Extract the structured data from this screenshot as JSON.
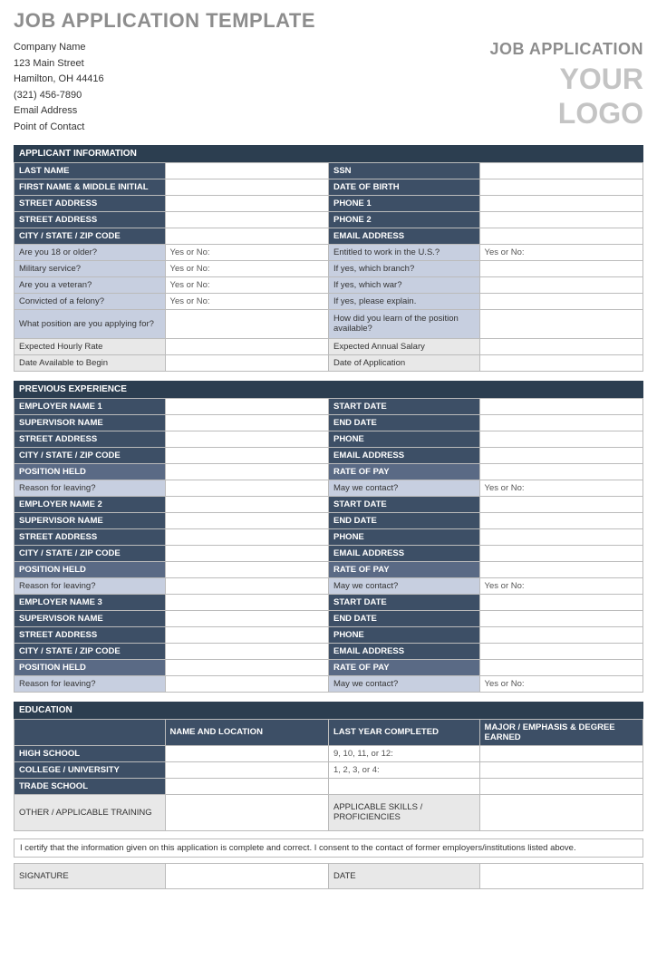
{
  "title": "JOB APPLICATION TEMPLATE",
  "header": {
    "company": "Company Name",
    "address1": "123 Main Street",
    "address2": "Hamilton, OH 44416",
    "phone": "(321) 456-7890",
    "email": "Email Address",
    "contact": "Point of Contact",
    "app_label": "JOB APPLICATION",
    "logo1": "YOUR",
    "logo2": "LOGO"
  },
  "sec_applicant": "APPLICANT INFORMATION",
  "ai": {
    "last_name": "LAST NAME",
    "ssn": "SSN",
    "first_mi": "FIRST NAME & MIDDLE INITIAL",
    "dob": "DATE OF BIRTH",
    "street1": "STREET ADDRESS",
    "phone1": "PHONE 1",
    "street2": "STREET ADDRESS",
    "phone2": "PHONE 2",
    "csz": "CITY / STATE / ZIP CODE",
    "email": "EMAIL ADDRESS",
    "q18": "Are you 18 or older?",
    "yn": "Yes or No:",
    "entitled": "Entitled to work in the U.S.?",
    "military": "Military service?",
    "branch": "If yes, which branch?",
    "veteran": "Are you a veteran?",
    "war": "If yes, which war?",
    "felony": "Convicted of a felony?",
    "explain": "If yes, please explain.",
    "position": "What position are you applying for?",
    "learn": "How did you learn of the position available?",
    "hourly": "Expected Hourly Rate",
    "salary": "Expected Annual Salary",
    "avail": "Date Available to Begin",
    "appdate": "Date of Application"
  },
  "sec_prev": "PREVIOUS EXPERIENCE",
  "pe": {
    "emp1": "EMPLOYER NAME 1",
    "emp2": "EMPLOYER NAME 2",
    "emp3": "EMPLOYER NAME 3",
    "sup": "SUPERVISOR NAME",
    "street": "STREET ADDRESS",
    "csz": "CITY / STATE / ZIP CODE",
    "pos": "POSITION HELD",
    "reason": "Reason for leaving?",
    "start": "START DATE",
    "end": "END DATE",
    "phone": "PHONE",
    "email": "EMAIL ADDRESS",
    "rate": "RATE OF PAY",
    "contact": "May we contact?",
    "yn": "Yes or No:"
  },
  "sec_edu": "EDUCATION",
  "edu": {
    "col_name": "NAME AND LOCATION",
    "col_year": "LAST YEAR COMPLETED",
    "col_major": "MAJOR / EMPHASIS & DEGREE EARNED",
    "hs": "HIGH SCHOOL",
    "hs_years": "9, 10, 11, or 12:",
    "college": "COLLEGE / UNIVERSITY",
    "col_years": "1, 2, 3, or 4:",
    "trade": "TRADE SCHOOL",
    "other": "OTHER / APPLICABLE TRAINING",
    "skills": "APPLICABLE SKILLS / PROFICIENCIES"
  },
  "cert": "I certify that the information given on this application is complete and correct. I consent to the contact of former employers/institutions listed above.",
  "sig": {
    "signature": "SIGNATURE",
    "date": "DATE"
  }
}
